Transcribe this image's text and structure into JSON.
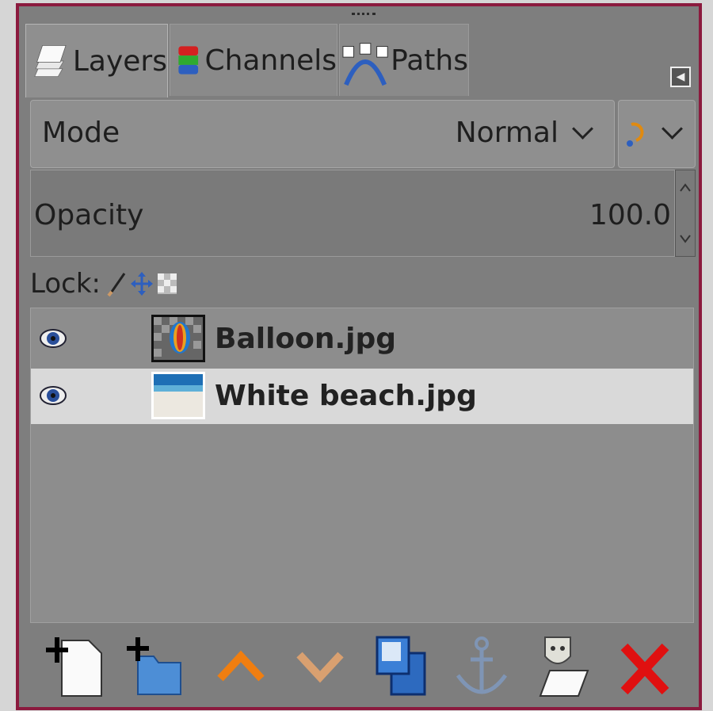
{
  "tabs": [
    {
      "label": "Layers",
      "icon": "layers-icon",
      "active": true
    },
    {
      "label": "Channels",
      "icon": "channels-icon",
      "active": false
    },
    {
      "label": "Paths",
      "icon": "paths-icon",
      "active": false
    }
  ],
  "mode": {
    "label": "Mode",
    "value": "Normal"
  },
  "opacity": {
    "label": "Opacity",
    "value": "100.0"
  },
  "lock": {
    "label": "Lock:"
  },
  "layers": [
    {
      "name": "Balloon.jpg",
      "visible": true,
      "selected": false
    },
    {
      "name": "White beach.jpg",
      "visible": true,
      "selected": true
    }
  ],
  "toolbar": [
    "new-layer-icon",
    "new-layer-group-icon",
    "raise-layer-icon",
    "lower-layer-icon",
    "duplicate-layer-icon",
    "anchor-layer-icon",
    "merge-down-icon",
    "delete-layer-icon"
  ],
  "colors": {
    "frame": "#8b1a3e",
    "selected_row": "#d9d9d9",
    "panel": "#7e7e7e"
  }
}
